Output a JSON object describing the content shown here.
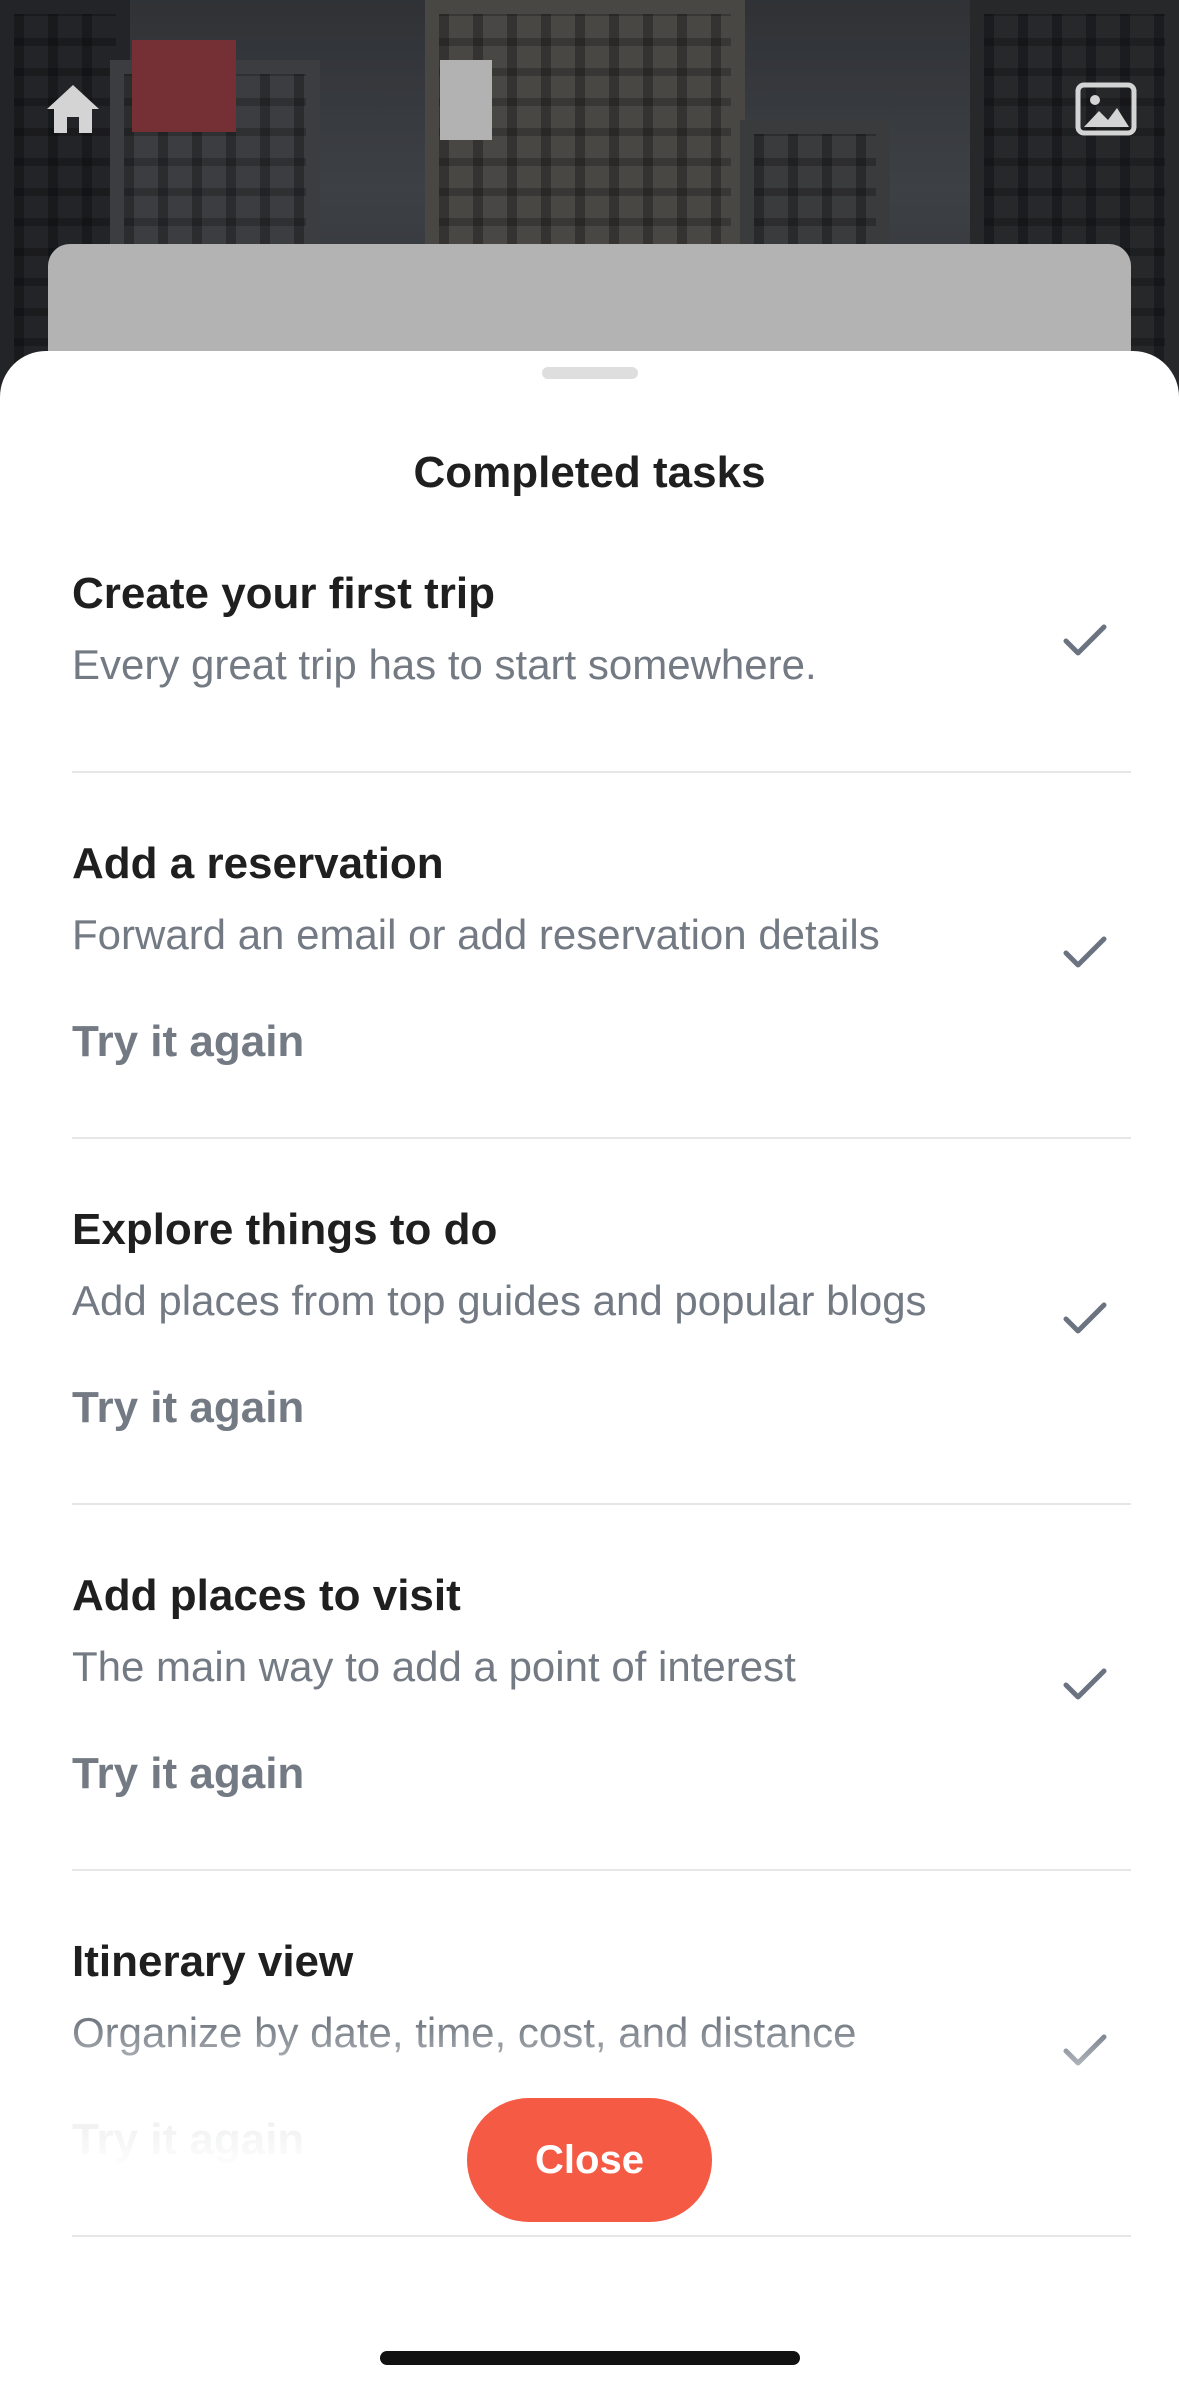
{
  "background": {
    "home_icon": "home-icon",
    "image_icon": "image-icon"
  },
  "sheet": {
    "title": "Completed tasks",
    "check_icon": "checkmark-icon"
  },
  "tasks": [
    {
      "title": "Create your first trip",
      "description": "Every great trip has to start somewhere.",
      "action": "",
      "completed": true
    },
    {
      "title": "Add a reservation",
      "description": "Forward an email or add reservation details",
      "action": "Try it again",
      "completed": true
    },
    {
      "title": "Explore things to do",
      "description": "Add places from top guides and popular blogs",
      "action": "Try it again",
      "completed": true
    },
    {
      "title": "Add places to visit",
      "description": "The main way to add a point of interest",
      "action": "Try it again",
      "completed": true
    },
    {
      "title": "Itinerary view",
      "description": "Organize by date, time, cost, and distance",
      "action": "Try it again",
      "completed": true
    }
  ],
  "close_button": {
    "label": "Close"
  },
  "colors": {
    "accent": "#f45a44",
    "title_text": "#1f1f1f",
    "secondary_text": "#737a83",
    "check": "#6b7380"
  }
}
